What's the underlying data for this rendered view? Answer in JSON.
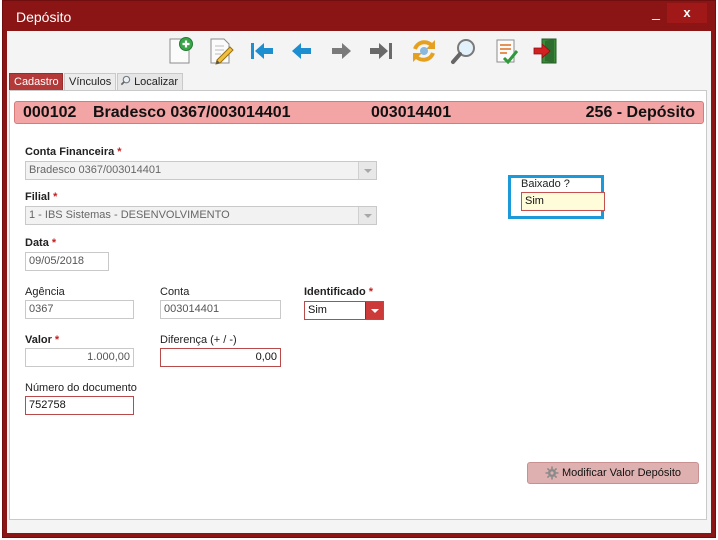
{
  "window": {
    "title": "Depósito",
    "minimize_label": "_",
    "close_label": "x"
  },
  "toolbar": {
    "buttons": [
      {
        "name": "new-document-icon"
      },
      {
        "name": "edit-document-icon"
      },
      {
        "name": "first-record-icon"
      },
      {
        "name": "previous-record-icon"
      },
      {
        "name": "next-record-icon"
      },
      {
        "name": "last-record-icon"
      },
      {
        "name": "refresh-icon"
      },
      {
        "name": "search-icon"
      },
      {
        "name": "checklist-icon"
      },
      {
        "name": "exit-icon"
      }
    ]
  },
  "tabs": [
    {
      "label": "Cadastro",
      "active": true
    },
    {
      "label": "Vínculos",
      "active": false
    },
    {
      "label": "Localizar",
      "active": false
    }
  ],
  "header": {
    "code": "000102",
    "account_name": "Bradesco 0367/003014401",
    "account_number": "003014401",
    "type": "256 - Depósito"
  },
  "form": {
    "conta_financeira": {
      "label": "Conta Financeira",
      "required": "*",
      "value": "Bradesco 0367/003014401"
    },
    "filial": {
      "label": "Filial",
      "required": "*",
      "value": "1 - IBS Sistemas - DESENVOLVIMENTO"
    },
    "data": {
      "label": "Data",
      "required": "*",
      "value": "09/05/2018"
    },
    "agencia": {
      "label": "Agência",
      "value": "0367"
    },
    "conta": {
      "label": "Conta",
      "value": "003014401"
    },
    "identificado": {
      "label": "Identificado",
      "required": "*",
      "value": "Sim"
    },
    "valor": {
      "label": "Valor",
      "required": "*",
      "value": "1.000,00"
    },
    "diferenca": {
      "label": "Diferença (+ / -)",
      "value": "0,00"
    },
    "numero_documento": {
      "label": "Número do documento",
      "value": "752758"
    },
    "baixado": {
      "label": "Baixado ?",
      "value": "Sim"
    }
  },
  "actions": {
    "modificar_label": "Modificar Valor Depósito"
  },
  "colors": {
    "window_frame": "#8b1414",
    "active_tab": "#b43a3a",
    "header_strip": "#f3a5a5",
    "highlight": "#1c99d8",
    "required_star": "#c62020"
  }
}
